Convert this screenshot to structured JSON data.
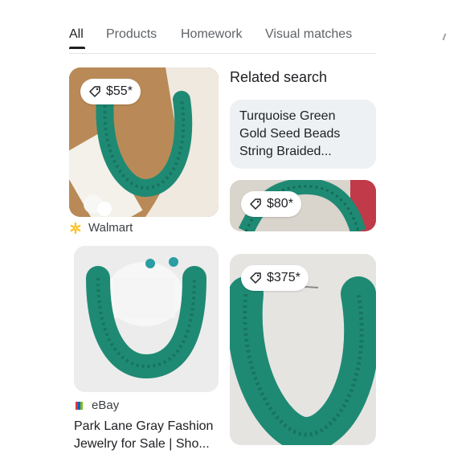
{
  "tabs": [
    {
      "label": "All",
      "active": true
    },
    {
      "label": "Products",
      "active": false
    },
    {
      "label": "Homework",
      "active": false
    },
    {
      "label": "Visual matches",
      "active": false
    }
  ],
  "results": {
    "card1": {
      "price": "$55*",
      "source": "Walmart"
    },
    "card2": {
      "price": "$80*"
    },
    "card3": {
      "source": "eBay",
      "title_line1": "Park Lane Gray Fashion",
      "title_line2": "Jewelry for Sale | Sho..."
    },
    "card4": {
      "price": "$375*"
    }
  },
  "related": {
    "heading": "Related search",
    "chip_line1": "Turquoise Green",
    "chip_line2": "Gold Seed Beads",
    "chip_line3": "String Braided..."
  },
  "colors": {
    "bead_green": "#1f8a73",
    "walmart_spark": "#ffc220"
  }
}
